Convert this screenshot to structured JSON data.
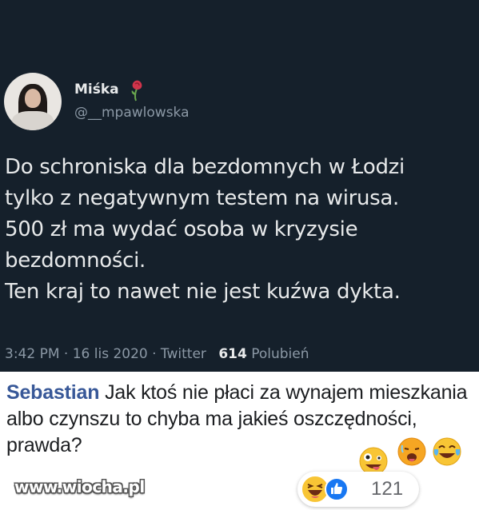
{
  "tweet": {
    "display_name": "Miśka",
    "handle": "@__mpawlowska",
    "text": "Do schroniska dla bezdomnych w Łodzi\ntylko z negatywnym testem na wirusa.\n500 zł ma wydać osoba w kryzysie\nbezdomności.\nTen kraj to nawet nie jest kuźwa dykta.",
    "time": "3:42 PM · 16 lis 2020 · Twitter",
    "likes_count": "614",
    "likes_label": "Polubień",
    "name_emoji": "wilted-rose-icon"
  },
  "comment": {
    "author": "Sebastian",
    "text": "Jak ktoś nie płaci za wynajem mieszkania albo czynszu to chyba ma jakieś oszczędności, prawda?",
    "inline_emojis": [
      "crazy-face-icon",
      "hot-face-icon",
      "joy-icon"
    ],
    "reactions": [
      "haha-reaction-icon",
      "like-reaction-icon"
    ],
    "reaction_count": "121"
  },
  "watermark": "www.wiocha.pl",
  "colors": {
    "tweet_bg": "#15202b",
    "tweet_text": "#e7e9ea",
    "tweet_muted": "#8b98a5",
    "author": "#385898",
    "like_blue": "#1877f2",
    "emoji_yellow": "#f8c535"
  }
}
